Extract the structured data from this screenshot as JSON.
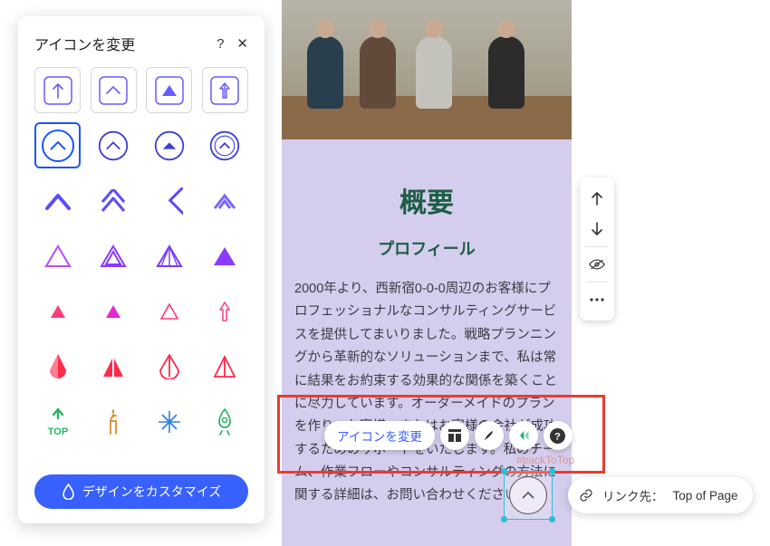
{
  "panel": {
    "title": "アイコンを変更",
    "help": "?",
    "customize": "デザインをカスタマイズ",
    "selected_index": 4
  },
  "page": {
    "h1": "概要",
    "h2": "プロフィール",
    "body": "2000年より、西新宿0-0-0周辺のお客様にプロフェッショナルなコンサルティングサービスを提供してまいりました。戦略プランニングから革新的なソリューションまで、私は常に結果をお約束する効果的な関係を築くことに尽力しています。オーダーメイドのプランを作り、お客様、またはお客様の会社が成功するためのサポートをいたします。私のチーム、作業フローやコンサルティングの方法に関する詳細は、お問い合わせください。",
    "btt_id": "#backToTop"
  },
  "toolpill": {
    "change_icon": "アイコンを変更"
  },
  "link_tip": {
    "label": "リンク先：",
    "dest": "Top of Page"
  }
}
